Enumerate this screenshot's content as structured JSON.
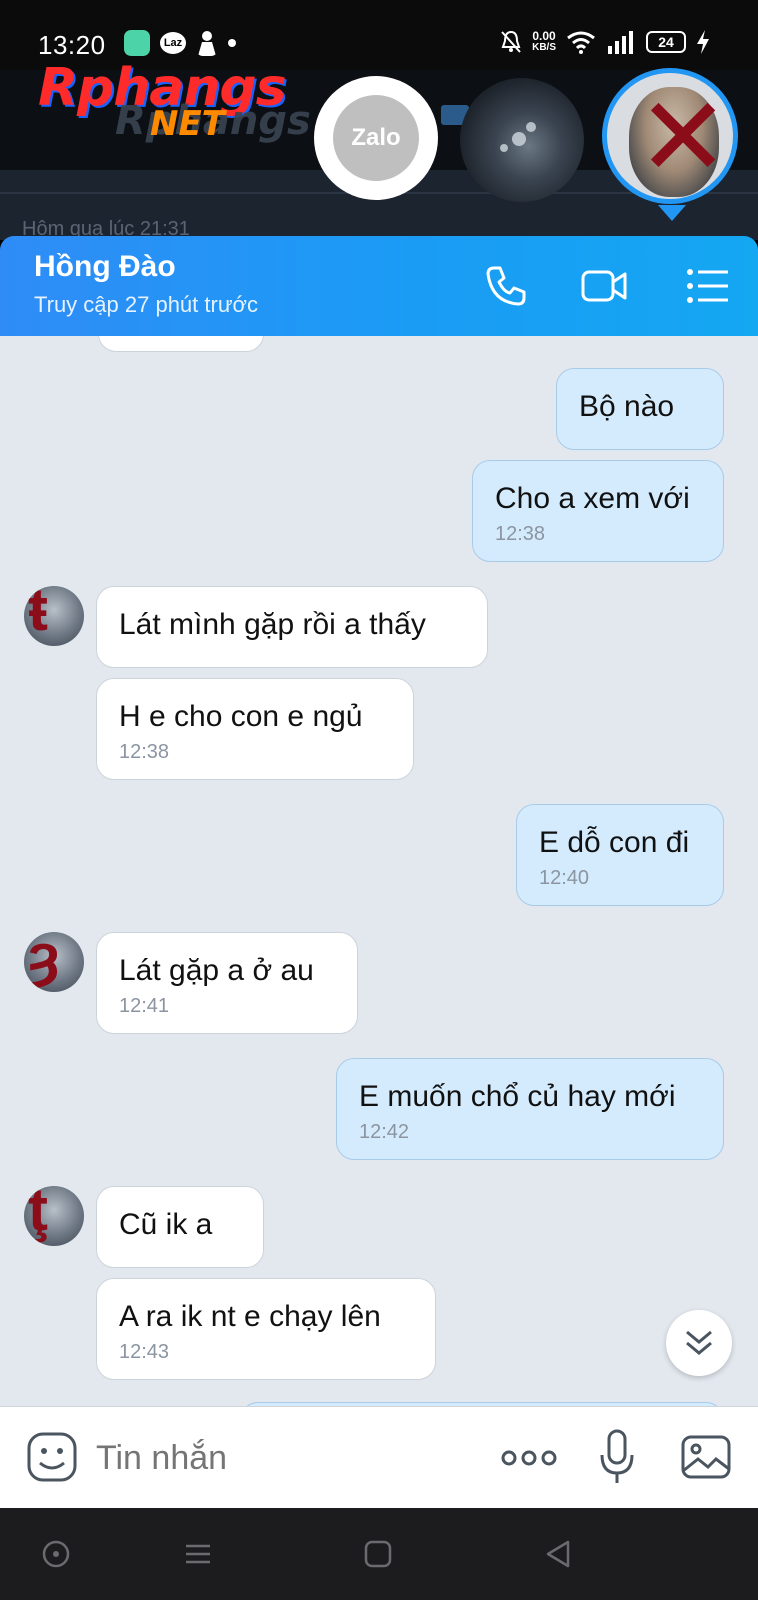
{
  "status_bar": {
    "time": "13:20",
    "laz_label": "Laz",
    "net_speed_value": "0.00",
    "net_speed_unit": "KB/S",
    "battery": "24"
  },
  "watermark": {
    "brand": "Rphangs",
    "brand_suffix": "NET",
    "ghost_brand": "Rphangs"
  },
  "background_strip": {
    "ghost_text": "Hôm qua lúc 21:31"
  },
  "bubble_heads": {
    "zalo_label": "Zalo"
  },
  "chat_header": {
    "contact_name": "Hồng Đào",
    "last_seen": "Truy cập 27 phút trước"
  },
  "messages": [
    {
      "direction": "out",
      "text": "Bộ nào",
      "time": ""
    },
    {
      "direction": "out",
      "text": "Cho a xem với",
      "time": "12:38"
    },
    {
      "direction": "in",
      "text": "Lát mình gặp rồi a thấy",
      "time": ""
    },
    {
      "direction": "in",
      "text": "H e cho con e ngủ",
      "time": "12:38"
    },
    {
      "direction": "out",
      "text": "E dỗ con đi",
      "time": "12:40"
    },
    {
      "direction": "in",
      "text": "Lát gặp a ở au",
      "time": "12:41"
    },
    {
      "direction": "out",
      "text": "E muốn chổ củ hay mới",
      "time": "12:42"
    },
    {
      "direction": "in",
      "text": "Cũ ik a",
      "time": ""
    },
    {
      "direction": "in",
      "text": "A ra ik nt e chạy lên",
      "time": "12:43"
    }
  ],
  "composer": {
    "placeholder": "Tin nhắn"
  },
  "colors": {
    "header_gradient_start": "#2f8cf7",
    "header_gradient_end": "#14a7f2",
    "outgoing_bubble": "#d4ebfd",
    "incoming_bubble": "#ffffff",
    "chat_background": "#e3e8ef"
  },
  "icons": {
    "call": "phone-icon",
    "video": "video-camera-icon",
    "menu": "list-menu-icon",
    "emoji": "sticker-face-icon",
    "more": "more-dots-icon",
    "mic": "microphone-icon",
    "gallery": "image-gallery-icon",
    "scroll": "double-chevron-down-icon"
  }
}
